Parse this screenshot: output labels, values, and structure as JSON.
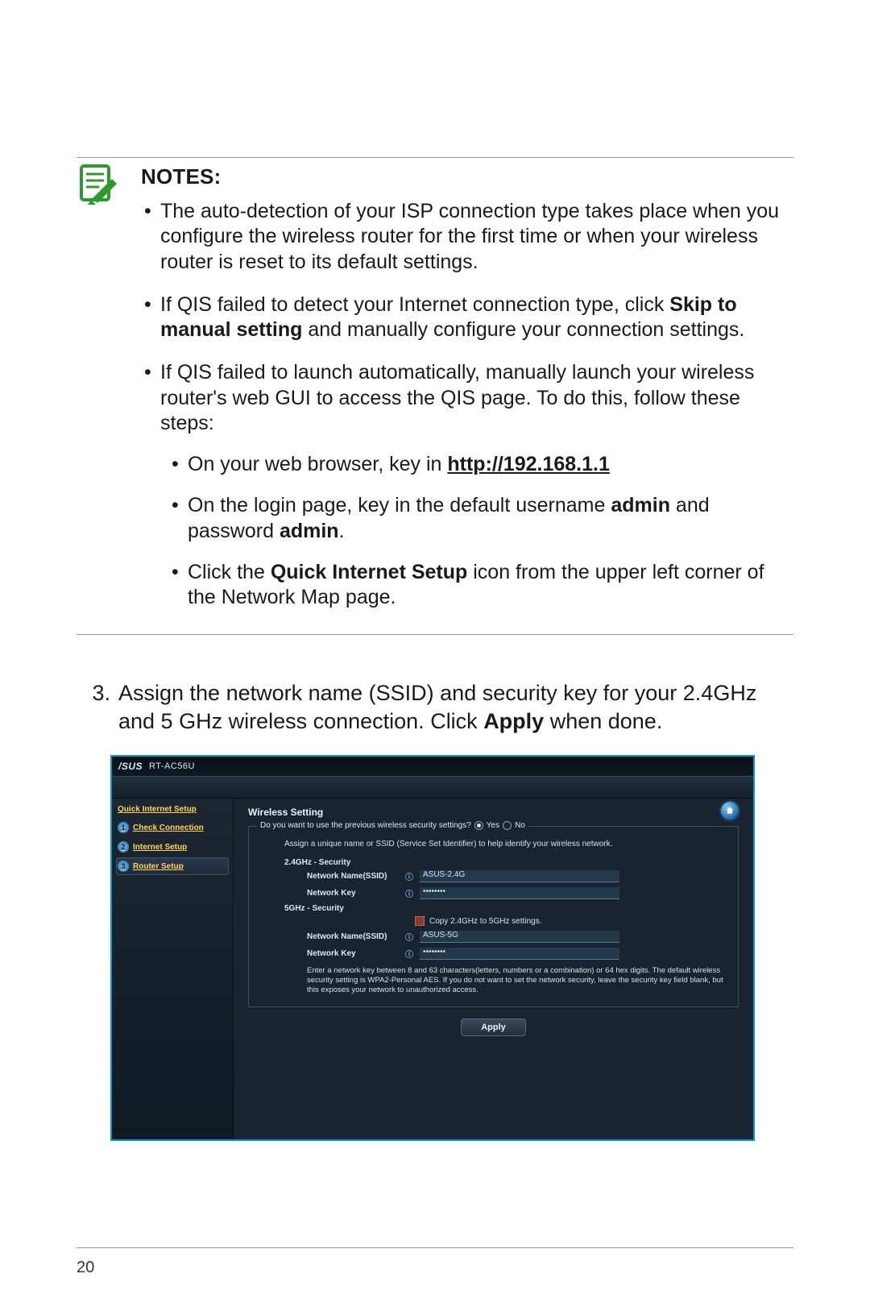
{
  "notes": {
    "heading": "NOTES",
    "items": [
      {
        "html": "The auto-detection of your ISP connection type takes place when you configure the wireless router for the first time or when your wireless router is reset to its default settings."
      },
      {
        "html": "If QIS failed to detect your Internet connection type, click <b>Skip to manual setting</b> and manually configure your connection settings."
      },
      {
        "html": "If QIS failed to launch automatically, manually launch your wireless router's web GUI to access the QIS page. To do this, follow these steps:",
        "sub": [
          {
            "html": "On your web browser, key in <b class='u'>http://192.168.1.1</b>"
          },
          {
            "html": "On the login page, key in the default username <b>admin</b> and password <b>admin</b>."
          },
          {
            "html": "Click the <b>Quick Internet Setup</b> icon from the upper left corner of the Network Map page."
          }
        ]
      }
    ]
  },
  "step": {
    "num": "3.",
    "html": "Assign the network name (SSID) and security key for your 2.4GHz and 5 GHz wireless connection. Click <b>Apply</b> when done."
  },
  "shot": {
    "brand": "/SUS",
    "model": "RT-AC56U",
    "sidebar": {
      "title": "Quick Internet Setup",
      "items": [
        {
          "num": "1",
          "label": "Check Connection",
          "active": false
        },
        {
          "num": "2",
          "label": "Internet Setup",
          "active": false
        },
        {
          "num": "3",
          "label": "Router Setup",
          "active": true
        }
      ]
    },
    "main": {
      "title": "Wireless Setting",
      "legend_q": "Do you want to use the previous wireless security settings?",
      "yes": "Yes",
      "no": "No",
      "help": "Assign a unique name or SSID (Service Set Identifier) to help identify your wireless network.",
      "sec24": "2.4GHz - Security",
      "sec5": "5GHz - Security",
      "lbl_name": "Network Name(SSID)",
      "lbl_key": "Network Key",
      "ssid24": "ASUS-2.4G",
      "key24": "••••••••",
      "ssid5": "ASUS-5G",
      "key5": "••••••••",
      "copy": "Copy 2.4GHz to 5GHz settings.",
      "disclaimer": "Enter a network key between 8 and 63 characters(letters, numbers or a combination) or 64 hex digits. The default wireless security setting is WPA2-Personal AES. If you do not want to set the network security, leave the security key field blank, but this exposes your network to unauthorized access.",
      "apply": "Apply"
    }
  },
  "page_number": "20"
}
